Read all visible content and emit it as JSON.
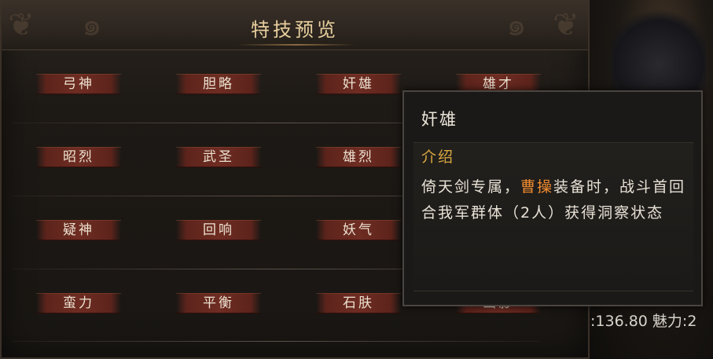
{
  "panel": {
    "title": "特技预览"
  },
  "skills": [
    [
      "弓神",
      "胆略",
      "奸雄",
      "雄才"
    ],
    [
      "昭烈",
      "武圣",
      "雄烈",
      ""
    ],
    [
      "疑神",
      "回响",
      "妖气",
      ""
    ],
    [
      "蛮力",
      "平衡",
      "石肤",
      "幽影"
    ]
  ],
  "tooltip": {
    "title": "奸雄",
    "intro_label": "介绍",
    "desc_part1": "倚天剑专属，",
    "desc_highlight": "曹操",
    "desc_part2": "装备时，战斗首回合我军群体（2人）获得洞察状态"
  },
  "status": {
    "stat_text": ":136.80 魅力:2"
  },
  "colors": {
    "accent_gold": "#e7cf9e",
    "intro_gold": "#d9a63e",
    "highlight_orange": "#ef8a2e",
    "button_red": "#6e2c22"
  }
}
